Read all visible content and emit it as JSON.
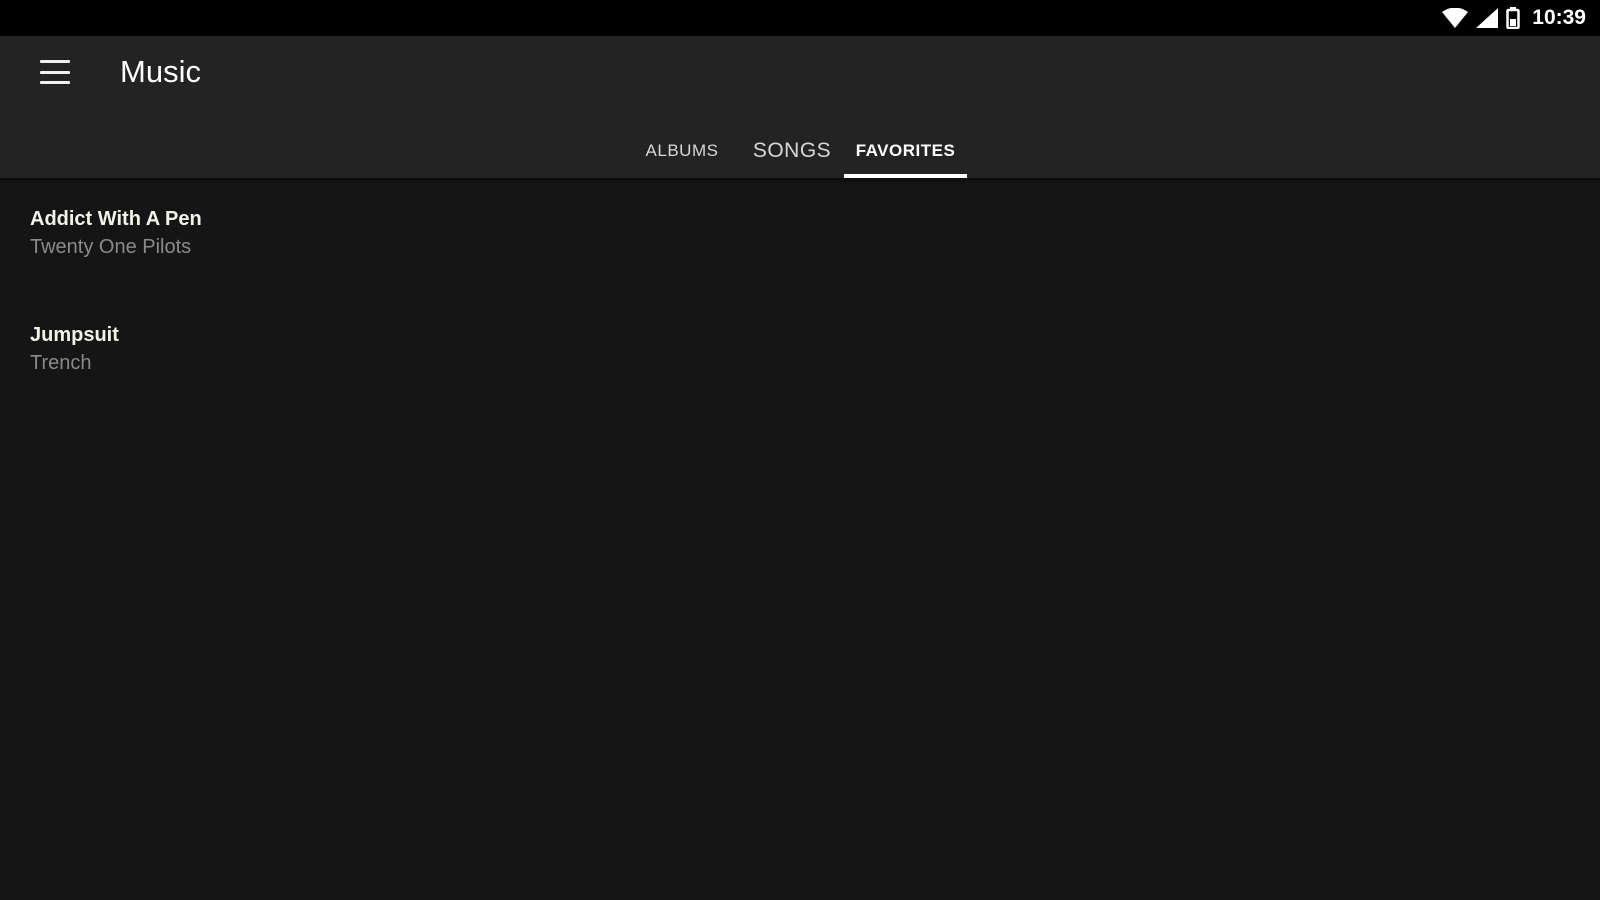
{
  "status_bar": {
    "time": "10:39",
    "icons": [
      "wifi-icon",
      "signal-icon",
      "battery-icon"
    ]
  },
  "app_bar": {
    "menu_icon": "hamburger-menu-icon",
    "title": "Music"
  },
  "tabs": [
    {
      "label": "ALBUMS",
      "selected": false
    },
    {
      "label": "SONGS",
      "selected": false
    },
    {
      "label": "FAVORITES",
      "selected": true
    }
  ],
  "songs": [
    {
      "title": "Addict With A Pen",
      "artist": "Twenty One Pilots"
    },
    {
      "title": "Jumpsuit",
      "artist": "Trench"
    }
  ],
  "colors": {
    "status_bar_bg": "#000000",
    "app_bar_bg": "#232323",
    "content_bg": "#151515",
    "title_text": "#f2f2ea",
    "subtitle_text": "#8a8a8a",
    "tab_indicator": "#ffffff"
  }
}
